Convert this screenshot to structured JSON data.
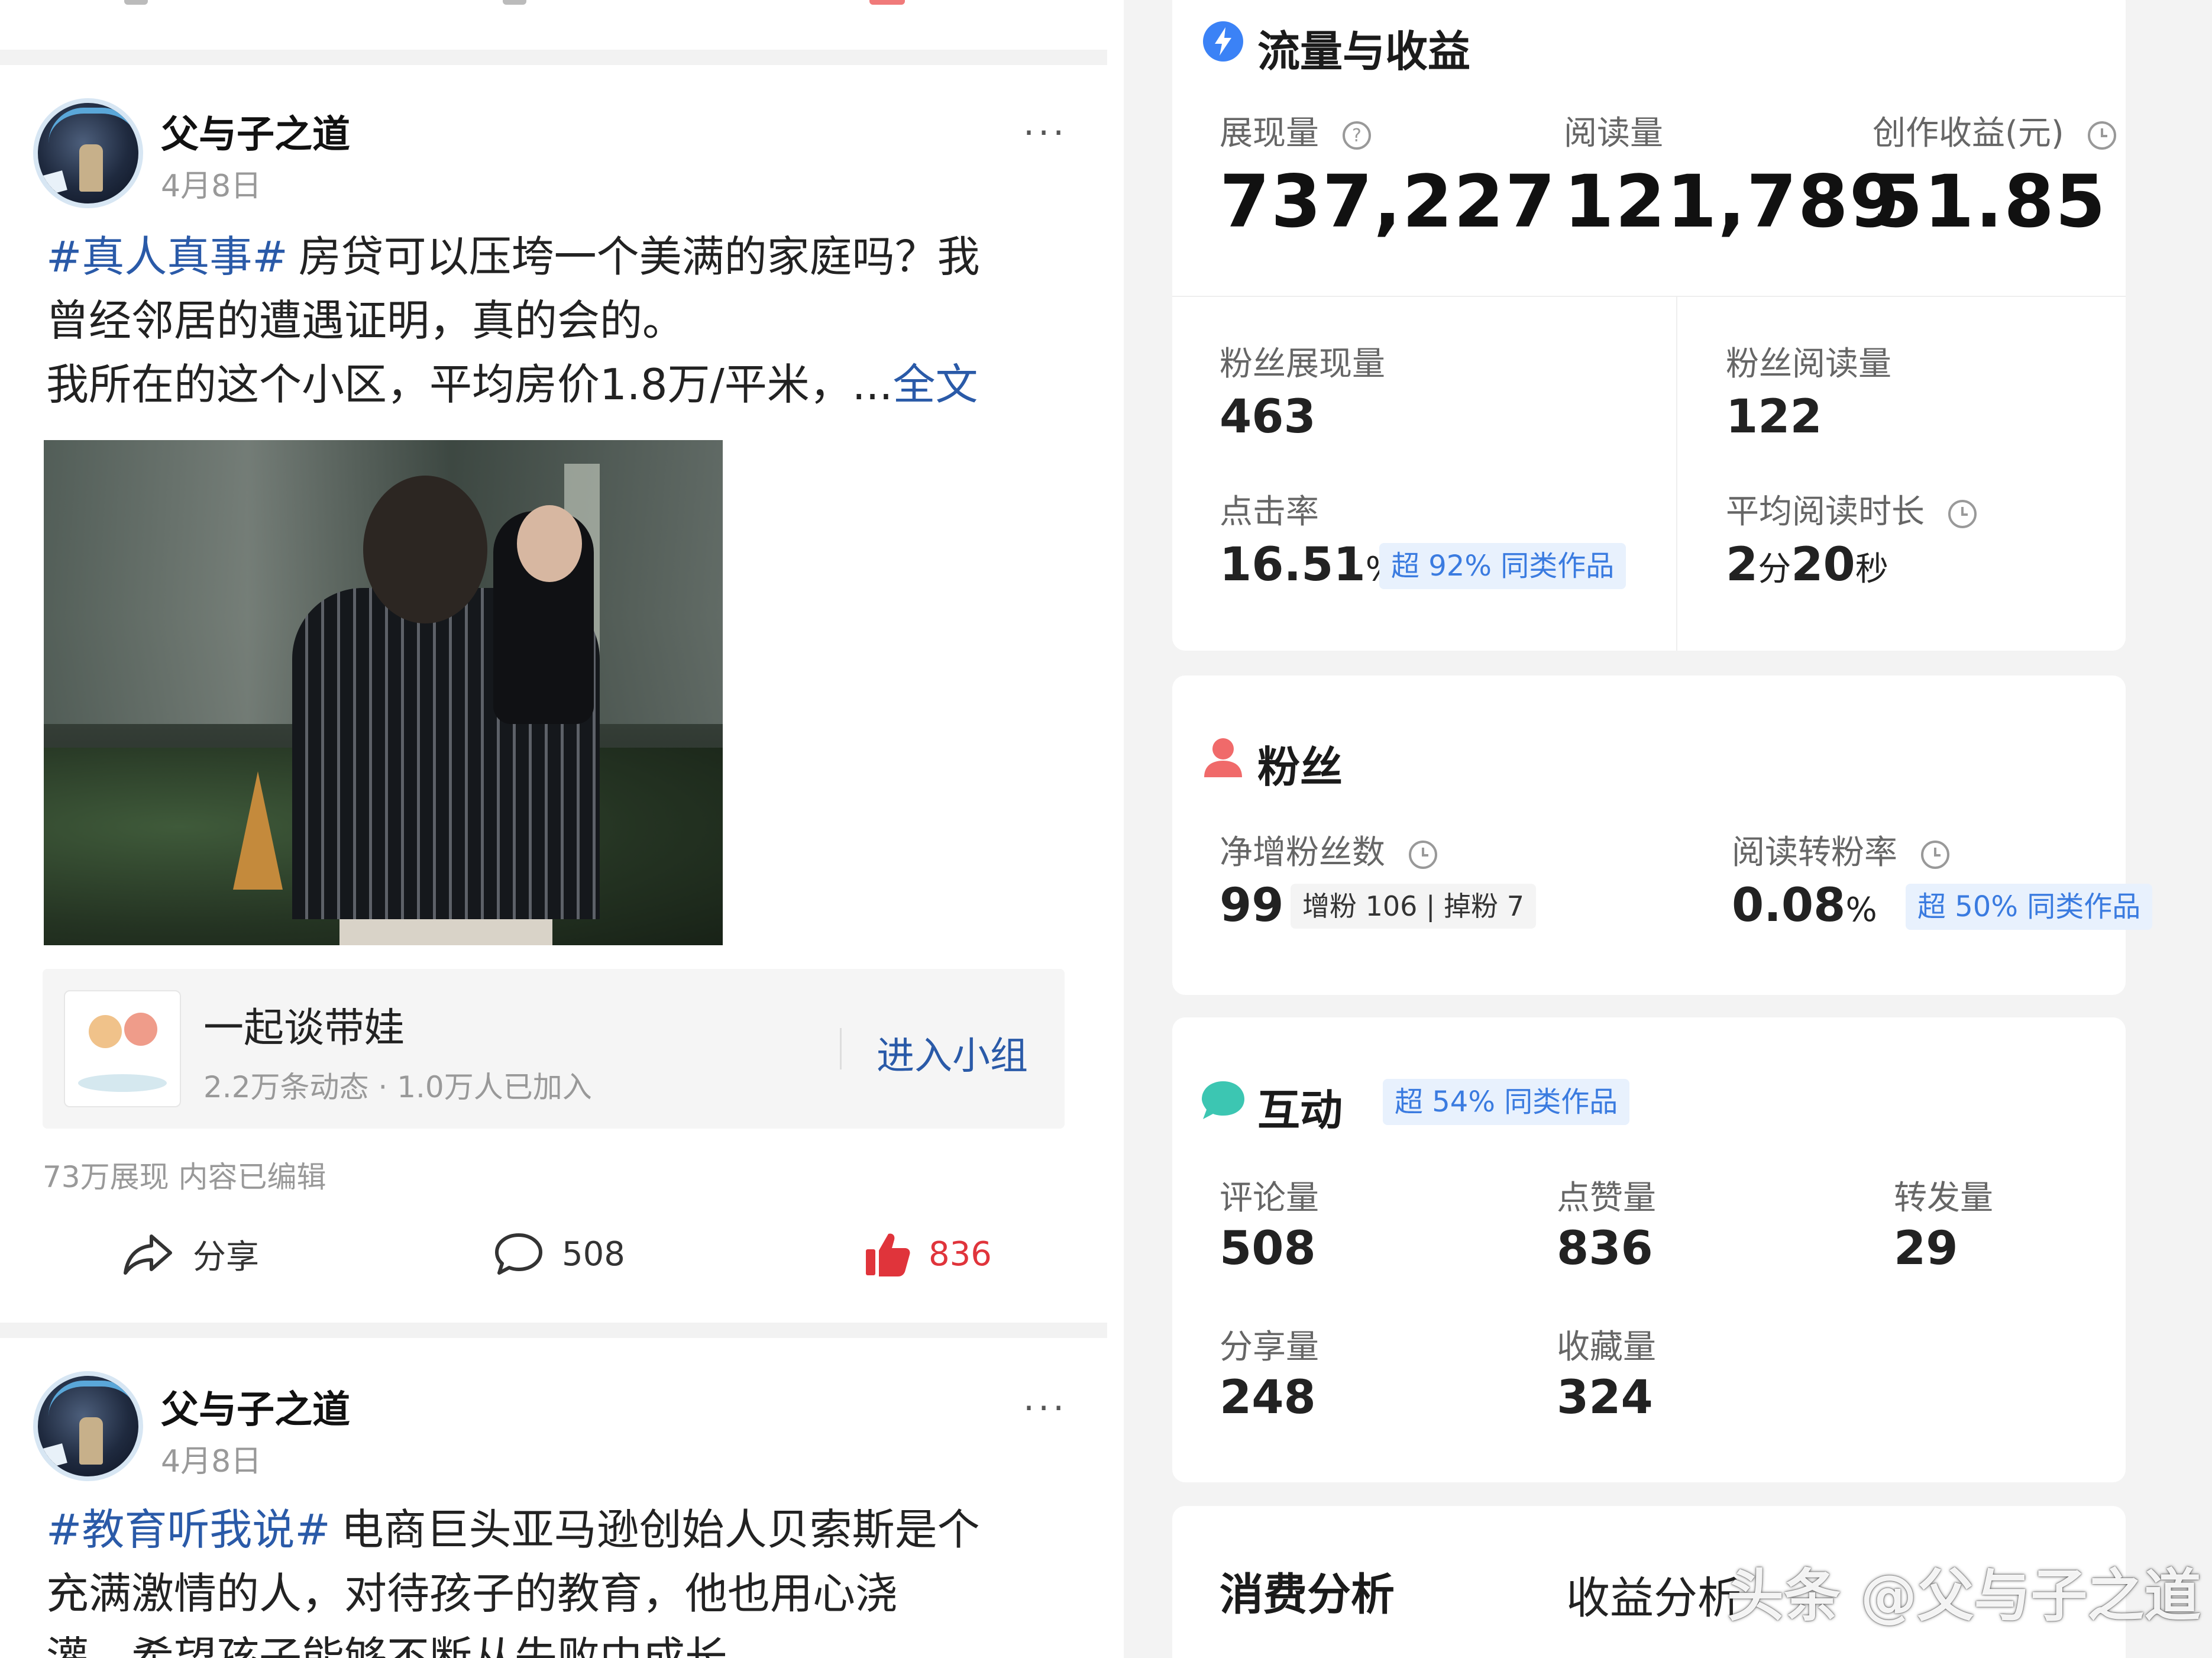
{
  "feed": {
    "posts": [
      {
        "author": "父与子之道",
        "date": "4月8日",
        "hashtag": "#真人真事#",
        "line1_rest": "房贷可以压垮一个美满的家庭吗？我",
        "line2": "曾经邻居的遭遇证明，真的会的。",
        "line3": "我所在的这个小区，平均房价1.8万/平米，...",
        "read_more": "全文",
        "group": {
          "name": "一起谈带娃",
          "meta": "2.2万条动态 · 1.0万人已加入",
          "join_label": "进入小组"
        },
        "stats": "73万展现   内容已编辑",
        "share_label": "分享",
        "comments": "508",
        "likes": "836"
      },
      {
        "author": "父与子之道",
        "date": "4月8日",
        "hashtag": "#教育听我说#",
        "line1_rest": "电商巨头亚马逊创始人贝索斯是个",
        "line2": "充满激情的人，对待孩子的教育，他也用心浇",
        "line3": "灌，希望孩子能够不断从失败中成长"
      }
    ],
    "more_glyph": "···"
  },
  "dashboard": {
    "traffic": {
      "title": "流量与收益",
      "impressions_label": "展现量",
      "impressions": "737,227",
      "reads_label": "阅读量",
      "reads": "121,789",
      "earnings_label": "创作收益(元)",
      "earnings": "51.85",
      "fan_impr_label": "粉丝展现量",
      "fan_impr": "463",
      "fan_reads_label": "粉丝阅读量",
      "fan_reads": "122",
      "ctr_label": "点击率",
      "ctr": "16.51",
      "ctr_unit": "%",
      "ctr_badge": "超 92% 同类作品",
      "avg_time_label": "平均阅读时长",
      "avg_time_min": "2",
      "avg_time_min_unit": "分",
      "avg_time_sec": "20",
      "avg_time_sec_unit": "秒"
    },
    "fans": {
      "title": "粉丝",
      "net_label": "净增粉丝数",
      "net": "99",
      "gain_badge": "增粉 106 | 掉粉 7",
      "conv_label": "阅读转粉率",
      "conv": "0.08",
      "conv_unit": "%",
      "conv_badge": "超 50% 同类作品"
    },
    "interaction": {
      "title": "互动",
      "badge": "超 54% 同类作品",
      "comments_label": "评论量",
      "comments": "508",
      "likes_label": "点赞量",
      "likes": "836",
      "forwards_label": "转发量",
      "forwards": "29",
      "shares_label": "分享量",
      "shares": "248",
      "favorites_label": "收藏量",
      "favorites": "324"
    },
    "tabs": {
      "consumption": "消费分析",
      "earnings": "收益分析"
    }
  },
  "watermark": "头条 @父与子之道",
  "colors": {
    "link_blue": "#2a5aa8",
    "like_red": "#e0343b",
    "badge_blue": "#3a7be0",
    "traffic_icon": "#3b82f6",
    "fans_icon": "#f06a6a",
    "interaction_icon": "#3cc6b2"
  },
  "icons": [
    "question-icon",
    "clock-icon",
    "bolt-icon",
    "person-icon",
    "chat-bubble-icon",
    "share-icon",
    "comment-icon",
    "thumb-up-icon",
    "more-icon"
  ]
}
